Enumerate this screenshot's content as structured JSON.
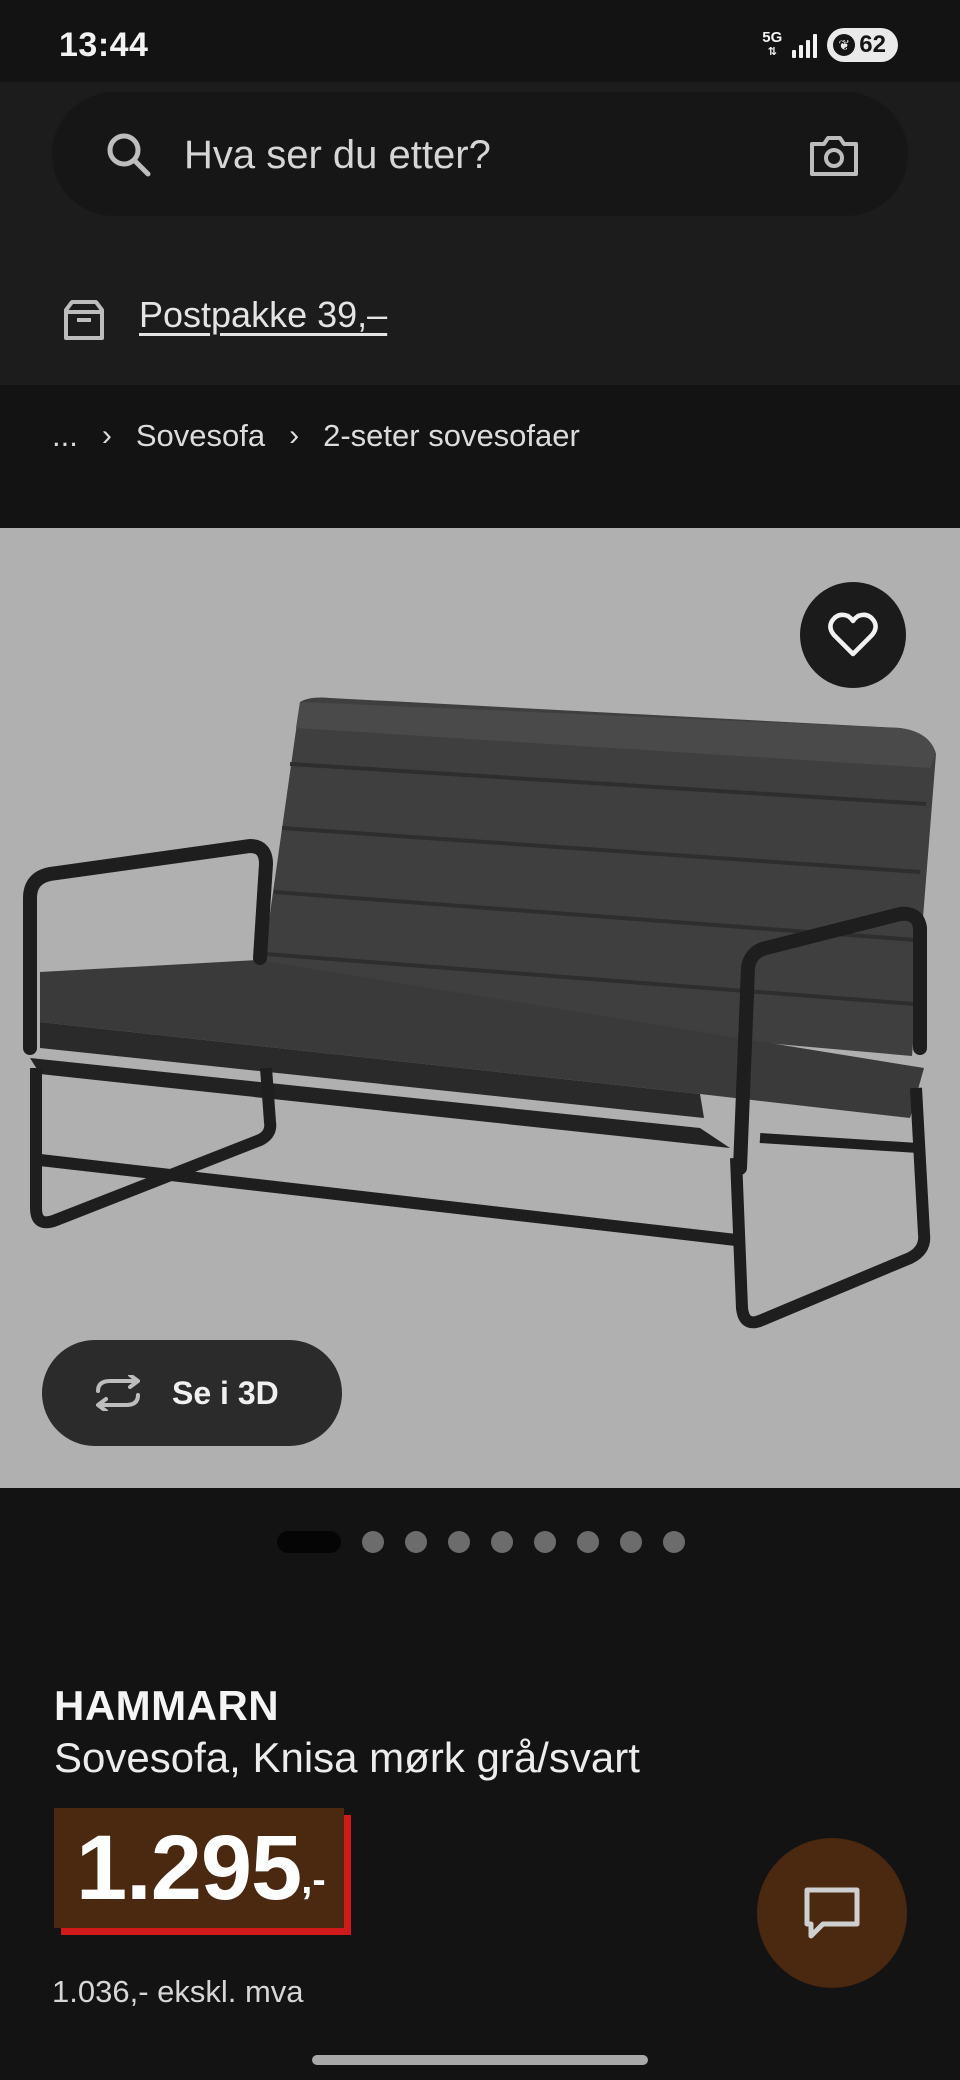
{
  "status_bar": {
    "time": "13:44",
    "network": "5G",
    "battery": "62",
    "battery_icon": "leaf-battery-icon"
  },
  "search": {
    "placeholder": "Hva ser du etter?",
    "left_icon": "search-icon",
    "right_icon": "camera-icon"
  },
  "shipping": {
    "icon": "box-icon",
    "label": "Postpakke 39,–"
  },
  "breadcrumb": {
    "ellipsis": "...",
    "items": [
      "Sovesofa",
      "2-seter sovesofaer"
    ]
  },
  "gallery": {
    "favorite_icon": "heart-icon",
    "view_3d_label": "Se i 3D",
    "view_3d_icon": "rotate-icon",
    "image_count": 9,
    "active_index": 0
  },
  "product": {
    "name": "HAMMARN",
    "description": "Sovesofa, Knisa mørk grå/svart",
    "price_main": "1.295",
    "price_suffix": ",-",
    "price_excl_vat": "1.036,- ekskl. mva"
  },
  "chat": {
    "icon": "chat-icon"
  },
  "colors": {
    "background": "#131313",
    "header": "#1c1c1c",
    "price_box": "#4b2810",
    "price_accent": "#d11a1a",
    "gallery_bg": "#b0b0b0"
  }
}
